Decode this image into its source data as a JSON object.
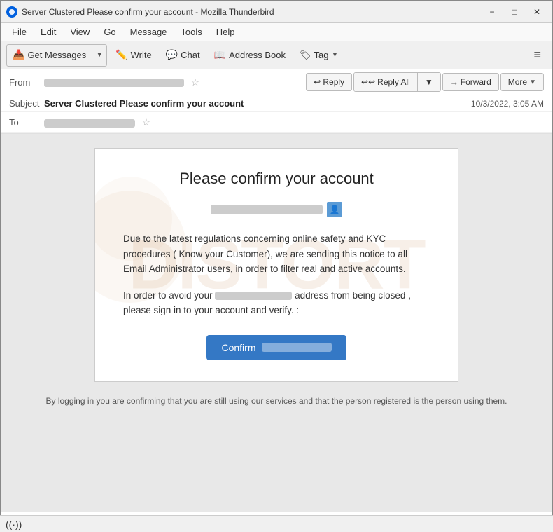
{
  "window": {
    "title": "Server Clustered Please confirm your account - Mozilla Thunderbird",
    "min_btn": "−",
    "max_btn": "□",
    "close_btn": "✕"
  },
  "menu": {
    "items": [
      "File",
      "Edit",
      "View",
      "Go",
      "Message",
      "Tools",
      "Help"
    ]
  },
  "toolbar": {
    "get_messages": "Get Messages",
    "write": "Write",
    "chat": "Chat",
    "address_book": "Address Book",
    "tag": "Tag",
    "hamburger": "≡"
  },
  "email_header": {
    "from_label": "From",
    "from_value_redacted": true,
    "subject_label": "Subject",
    "subject": "Server Clustered Please confirm your account",
    "date": "10/3/2022, 3:05 AM",
    "to_label": "To",
    "to_value_redacted": true,
    "reply_btn": "Reply",
    "reply_all_btn": "Reply All",
    "forward_btn": "Forward",
    "more_btn": "More"
  },
  "email_body": {
    "title": "Please confirm your account",
    "paragraph1": "Due to the latest regulations concerning online safety and KYC procedures ( Know your Customer), we are sending this notice to all Email Administrator users, in order to filter real and active accounts.",
    "paragraph2_before": "In order to avoid your",
    "paragraph2_after": "address from being closed  ,\nplease sign in to your account and verify. :",
    "confirm_label": "Confirm",
    "footer": "By logging in you are confirming that you are still using our services and that the person registered is the\nperson using them."
  },
  "status_bar": {
    "signal_label": "((·))"
  }
}
